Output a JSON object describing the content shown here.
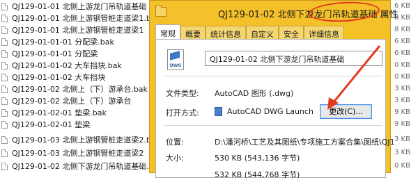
{
  "file_list": {
    "items": [
      "QJ129-01-01 北侧上游龙门吊轨道基础",
      "QJ129-01-01 北侧上游钢管桩走道梁1.bak",
      "QJ129-01-01 北侧上游钢管桩走道梁1",
      "QJ129-01-01-01 分配梁.bak",
      "QJ129-01-01-01 分配梁",
      "QJ129-01-01-02 大车挡块.bak",
      "QJ129-01-01-02 大车挡块",
      "QJ129-01-02 北侧上（下）游承台.bak",
      "QJ129-01-02 北侧上（下）游承台",
      "QJ129-01-02-01 垫梁.bak",
      "QJ129-01-02-01 垫梁",
      "QJ129-01-03 北侧上游钢管桩走道梁2.bak",
      "QJ129-01-03 北侧上游钢管桩走道梁2",
      "QJ129-01-02 北侧下游龙门吊轨道基础.bak"
    ]
  },
  "right_col": {
    "sizes": [
      "6 KB",
      "8 KB",
      "8 KB",
      "6 KB",
      "6 KB",
      "0 KB",
      "0 KB",
      "3 KB",
      "3 KB",
      "9 KB",
      "9 KB",
      "3 KB",
      "3 KB",
      "0 KB"
    ]
  },
  "dialog": {
    "title": "QJ129-01-02 北侧下游龙门吊轨道基础 属性",
    "tabs": [
      "常规",
      "概要",
      "统计信息",
      "自定义",
      "安全",
      "详细信息"
    ],
    "file_name": "QJ129-01-02 北侧下游龙门吊轨道基础",
    "icon_text": "DWG",
    "file_type_label": "文件类型:",
    "file_type_value": "AutoCAD 图形 (.dwg)",
    "open_with_label": "打开方式:",
    "open_with_value": "AutoCAD DWG Launch",
    "change_button": "更改(C)...",
    "location_label": "位置:",
    "location_value": "D:\\潘河桥\\工艺及其图纸\\专项施工方案合集\\图纸\\QJ1",
    "size_label": "大小:",
    "size_value": "530 KB (543,136 字节)",
    "size_on_disk_value": "532 KB (544,768 字节)",
    "annotation_color": "#e23a1e",
    "accent_color": "#f4c224"
  }
}
